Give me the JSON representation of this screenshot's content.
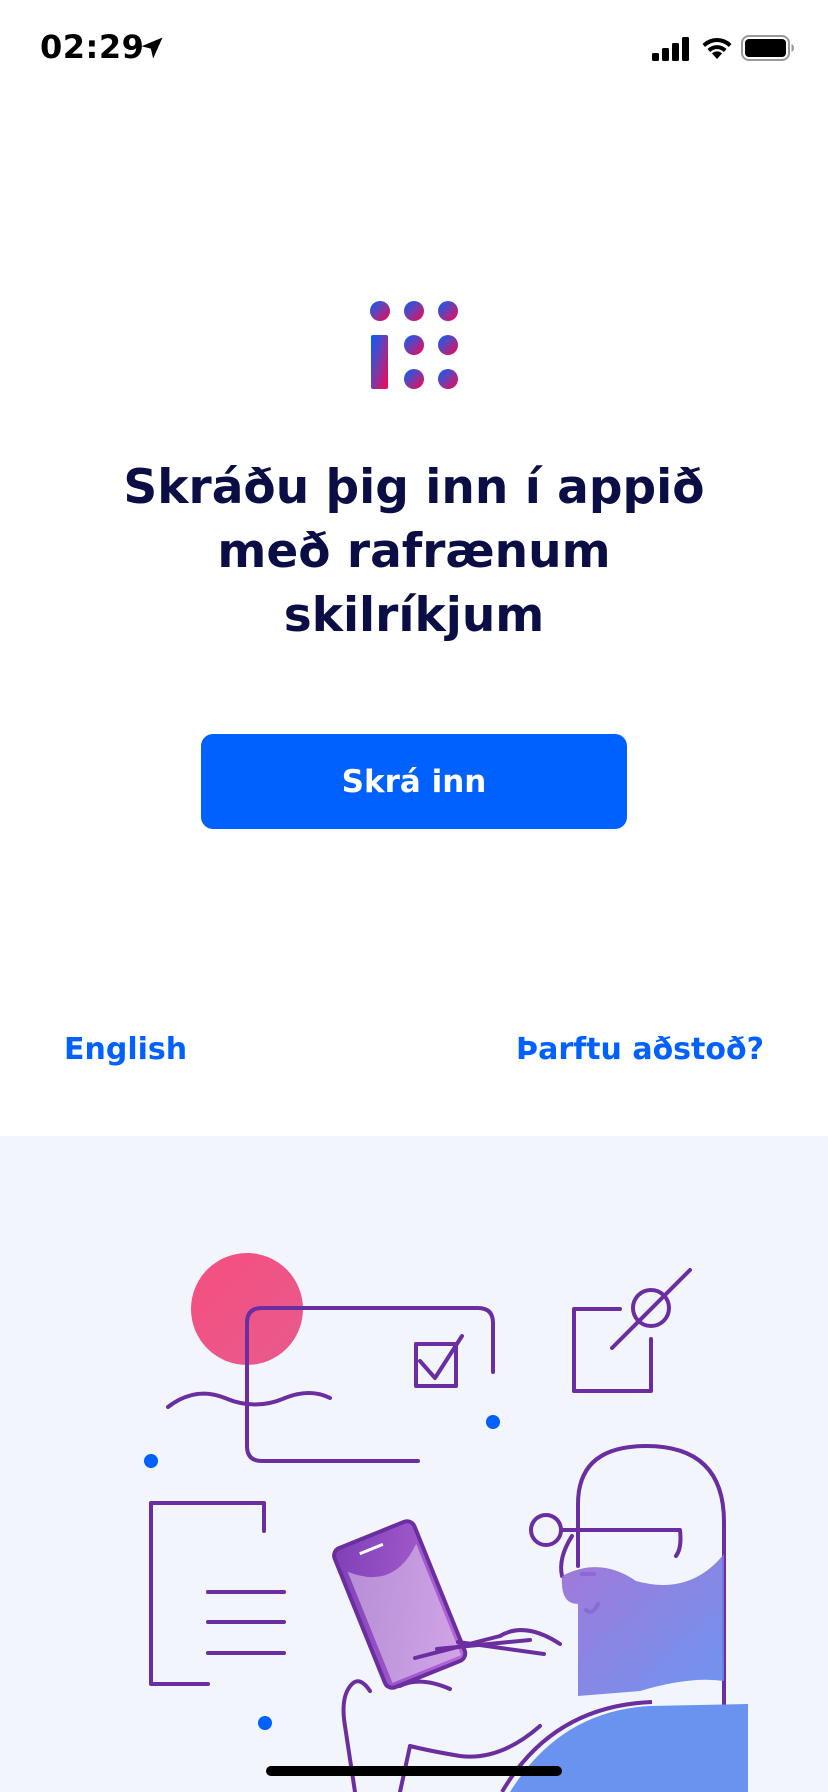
{
  "status_bar": {
    "time": "02:29",
    "icons": [
      "location-arrow-icon",
      "cellular-signal-icon",
      "wifi-icon",
      "battery-icon"
    ]
  },
  "logo": {
    "icon": "island-is-logo-icon"
  },
  "headline": "Skráðu þig inn í appið með rafrænum skilríkjum",
  "login_button": {
    "label": "Skrá inn",
    "color": "#0061ff"
  },
  "footer": {
    "language_link": "English",
    "help_link": "Þarftu aðstoð?"
  },
  "colors": {
    "primary": "#0061ff",
    "headline": "#0b0d45",
    "illustration_bg": "#f2f6fc",
    "illustration_stroke": "#6a2ea0",
    "accent_pink": "#f0507a"
  }
}
